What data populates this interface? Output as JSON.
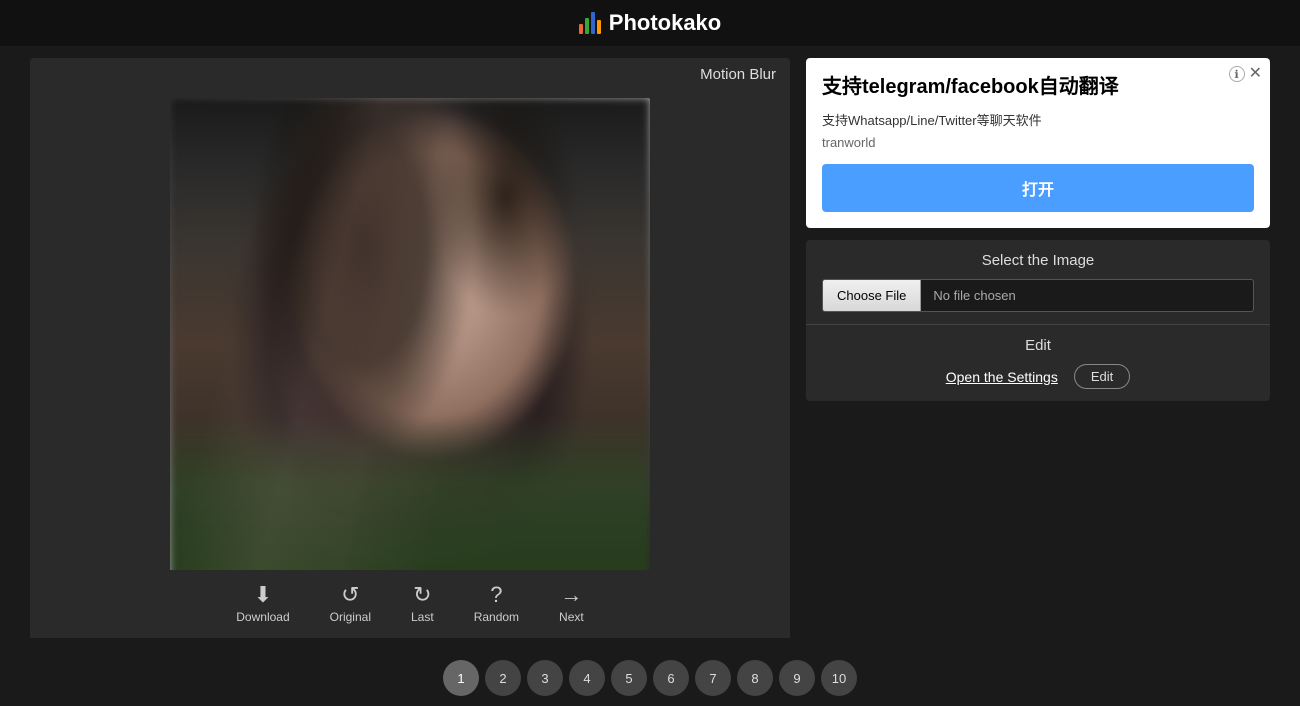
{
  "header": {
    "title": "Photokako",
    "logo_alt": "photokako-logo"
  },
  "left_panel": {
    "effect_title": "Motion Blur",
    "toolbar": {
      "buttons": [
        {
          "id": "download",
          "icon": "⬇",
          "label": "Download"
        },
        {
          "id": "original",
          "icon": "↺",
          "label": "Original"
        },
        {
          "id": "last",
          "icon": "↻",
          "label": "Last"
        },
        {
          "id": "random",
          "icon": "?",
          "label": "Random"
        },
        {
          "id": "next",
          "icon": "→",
          "label": "Next"
        }
      ]
    }
  },
  "ad": {
    "title": "支持telegram/facebook自动翻译",
    "subtitle": "支持Whatsapp/Line/Twitter等聊天软件",
    "brand": "tranworld",
    "cta_label": "打开",
    "info_icon": "ℹ",
    "close_icon": "✕"
  },
  "right_panel": {
    "select_section": {
      "title": "Select the Image",
      "choose_file_label": "Choose File",
      "no_file_label": "No file chosen"
    },
    "edit_section": {
      "title": "Edit",
      "open_settings_label": "Open the Settings",
      "edit_btn_label": "Edit"
    }
  },
  "pagination": {
    "pages": [
      "1",
      "2",
      "3",
      "4",
      "5",
      "6",
      "7",
      "8",
      "9",
      "10"
    ]
  }
}
